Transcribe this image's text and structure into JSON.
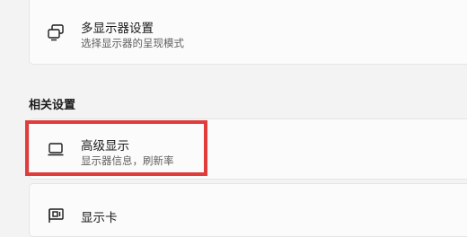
{
  "multi_display": {
    "title": "多显示器设置",
    "subtitle": "选择显示器的呈现模式",
    "icon": "multi-monitor-icon"
  },
  "related_settings": {
    "heading": "相关设置",
    "items": [
      {
        "title": "高级显示",
        "subtitle": "显示器信息，刷新率",
        "icon": "monitor-icon",
        "highlighted": true
      },
      {
        "title": "显示卡",
        "icon": "graphics-card-icon"
      }
    ]
  },
  "colors": {
    "highlight": "#e03c3c",
    "background": "#f3f3f3",
    "card": "#fbfbfb"
  }
}
